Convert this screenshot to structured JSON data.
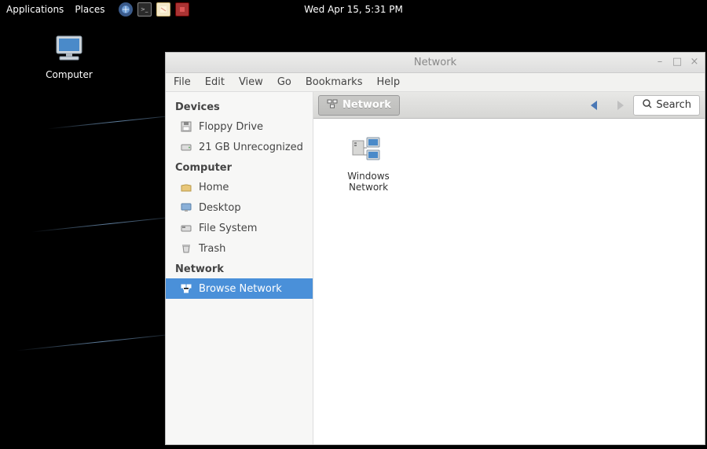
{
  "panel": {
    "applications": "Applications",
    "places": "Places",
    "clock": "Wed Apr 15,  5:31 PM"
  },
  "desktop": {
    "computer_label": "Computer"
  },
  "window": {
    "title": "Network",
    "menus": {
      "file": "File",
      "edit": "Edit",
      "view": "View",
      "go": "Go",
      "bookmarks": "Bookmarks",
      "help": "Help"
    },
    "sidebar": {
      "devices_header": "Devices",
      "devices": [
        {
          "label": "Floppy Drive"
        },
        {
          "label": "21 GB Unrecognized"
        }
      ],
      "computer_header": "Computer",
      "computer": [
        {
          "label": "Home"
        },
        {
          "label": "Desktop"
        },
        {
          "label": "File System"
        },
        {
          "label": "Trash"
        }
      ],
      "network_header": "Network",
      "network": [
        {
          "label": "Browse Network"
        }
      ]
    },
    "toolbar": {
      "location_label": "Network",
      "search_label": "Search"
    },
    "files": [
      {
        "label": "Windows Network"
      }
    ]
  }
}
